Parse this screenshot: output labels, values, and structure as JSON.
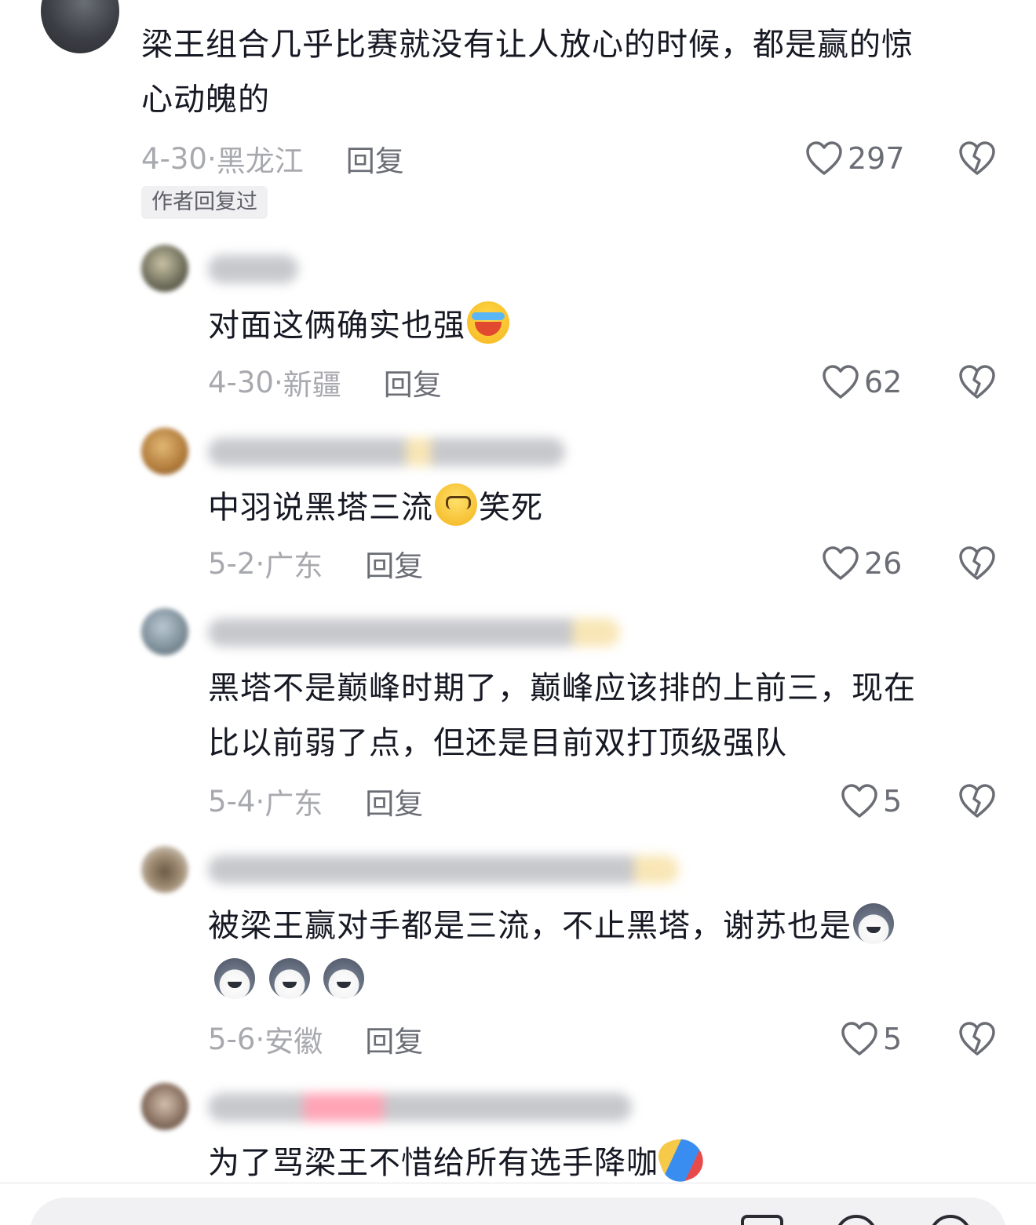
{
  "comments": [
    {
      "text_line1": "梁王组合几乎比赛就没有让人放心的时候，都是赢的惊",
      "text_line2": "心动魄的",
      "date": "4-30",
      "location": "黑龙江",
      "reply_label": "回复",
      "likes": "297",
      "badge": "作者回复过"
    },
    {
      "text": "对面这俩确实也强",
      "emoji": "laughing-crying-emoji",
      "date": "4-30",
      "location": "新疆",
      "reply_label": "回复",
      "likes": "62"
    },
    {
      "text_before": "中羽说黑塔三流",
      "emoji": "thinking-emoji",
      "text_after": "笑死",
      "date": "5-2",
      "location": "广东",
      "reply_label": "回复",
      "likes": "26"
    },
    {
      "text_line1": "黑塔不是巅峰时期了，巅峰应该排的上前三，现在",
      "text_line2": "比以前弱了点，但还是目前双打顶级强队",
      "date": "5-4",
      "location": "广东",
      "reply_label": "回复",
      "likes": "5"
    },
    {
      "text_line1": "被梁王赢对手都是三流，不止黑塔，谢苏也是",
      "emoji": "husky-dog-emoji",
      "date": "5-6",
      "location": "安徽",
      "reply_label": "回复",
      "likes": "5"
    },
    {
      "text": "为了骂梁王不惜给所有选手降咖",
      "emoji": "falling-man-emoji"
    }
  ],
  "colors": {
    "text": "#161823",
    "meta": "#a8a9ae",
    "action": "#6b6d75"
  }
}
